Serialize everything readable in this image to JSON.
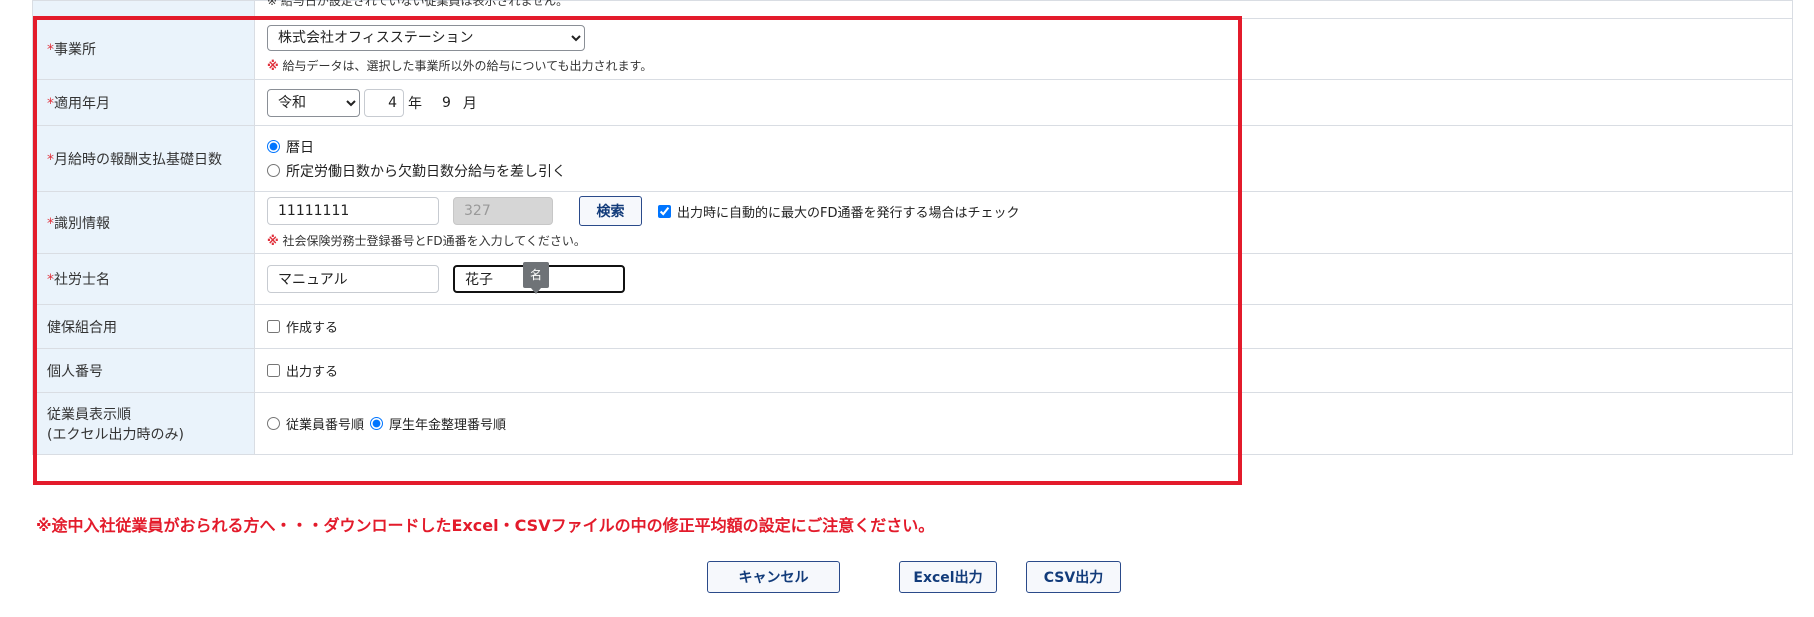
{
  "top_note": "※ 給与日が設定されていない従業員は表示されません。",
  "office": {
    "label": "事業所",
    "required_mark": "*",
    "selected": "株式会社オフィスステーション",
    "note_mark": "※",
    "note": "給与データは、選択した事業所以外の給与についても出力されます。"
  },
  "period": {
    "label": "適用年月",
    "required_mark": "*",
    "era": "令和",
    "year": "4",
    "year_unit": "年",
    "month": "9",
    "month_unit": "月"
  },
  "basis_days": {
    "label": "月給時の報酬支払基礎日数",
    "required_mark": "*",
    "option1": "暦日",
    "option2": "所定労働日数から欠勤日数分給与を差し引く"
  },
  "identification": {
    "label": "識別情報",
    "required_mark": "*",
    "reg_number": "11111111",
    "fd_number": "327",
    "search_label": "検索",
    "auto_fd_label": "出力時に自動的に最大のFD通番を発行する場合はチェック",
    "note_mark": "※",
    "note": "社会保険労務士登録番号とFD通番を入力してください。",
    "tooltip": "名"
  },
  "consultant_name": {
    "label": "社労士名",
    "required_mark": "*",
    "last_name": "マニュアル",
    "first_name": "花子"
  },
  "health_union": {
    "label": "健保組合用",
    "checkbox_label": "作成する"
  },
  "personal_number": {
    "label": "個人番号",
    "checkbox_label": "出力する"
  },
  "display_order": {
    "label_line1": "従業員表示順",
    "label_line2": "(エクセル出力時のみ)",
    "option1": "従業員番号順",
    "option2": "厚生年金整理番号順"
  },
  "warning": "※途中入社従業員がおられる方へ・・・ダウンロードしたExcel・CSVファイルの中の修正平均額の設定にご注意ください。",
  "buttons": {
    "cancel": "キャンセル",
    "excel": "Excel出力",
    "csv": "CSV出力"
  },
  "colors": {
    "highlight_border": "#e31b2b",
    "label_bg": "#eaf3fb",
    "button_text": "#123b7a"
  }
}
